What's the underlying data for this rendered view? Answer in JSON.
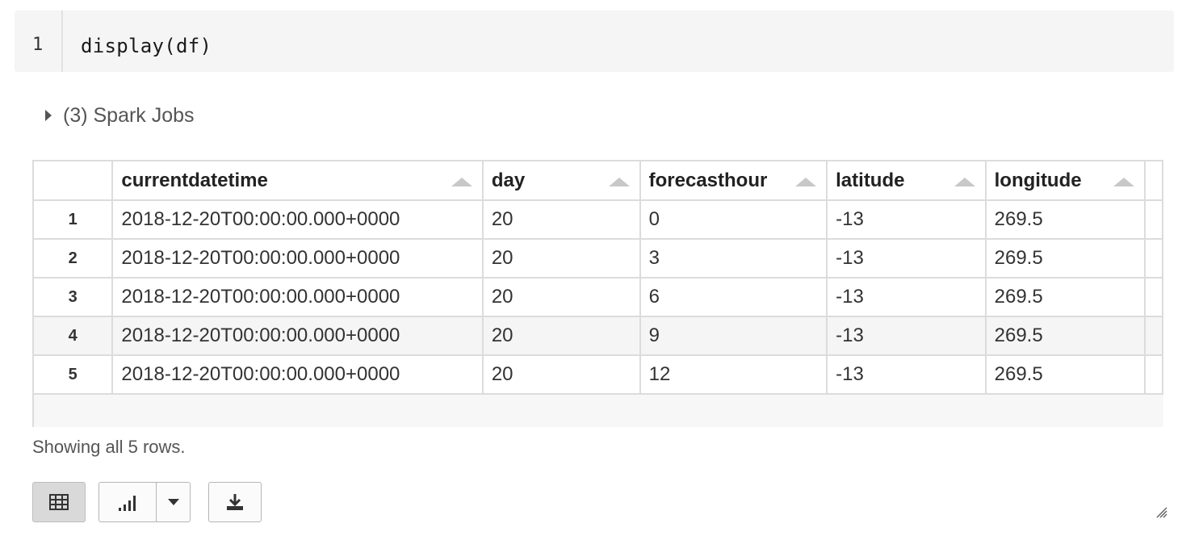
{
  "cell": {
    "line_number": "1",
    "code": "display(df)"
  },
  "spark_jobs": {
    "label": "(3) Spark Jobs"
  },
  "table": {
    "columns": [
      "currentdatetime",
      "day",
      "forecasthour",
      "latitude",
      "longitude"
    ],
    "rows": [
      {
        "index": "1",
        "values": [
          "2018-12-20T00:00:00.000+0000",
          "20",
          "0",
          "-13",
          "269.5"
        ]
      },
      {
        "index": "2",
        "values": [
          "2018-12-20T00:00:00.000+0000",
          "20",
          "3",
          "-13",
          "269.5"
        ]
      },
      {
        "index": "3",
        "values": [
          "2018-12-20T00:00:00.000+0000",
          "20",
          "6",
          "-13",
          "269.5"
        ]
      },
      {
        "index": "4",
        "values": [
          "2018-12-20T00:00:00.000+0000",
          "20",
          "9",
          "-13",
          "269.5"
        ]
      },
      {
        "index": "5",
        "values": [
          "2018-12-20T00:00:00.000+0000",
          "20",
          "12",
          "-13",
          "269.5"
        ]
      }
    ],
    "highlighted_row": 3
  },
  "status": {
    "showing": "Showing all 5 rows."
  },
  "icons": {
    "table_view": "table-icon",
    "chart_view": "bar-chart-icon",
    "dropdown": "chevron-down-icon",
    "download": "download-icon",
    "sort": "sort-ascending-icon",
    "expand": "caret-right-icon"
  }
}
